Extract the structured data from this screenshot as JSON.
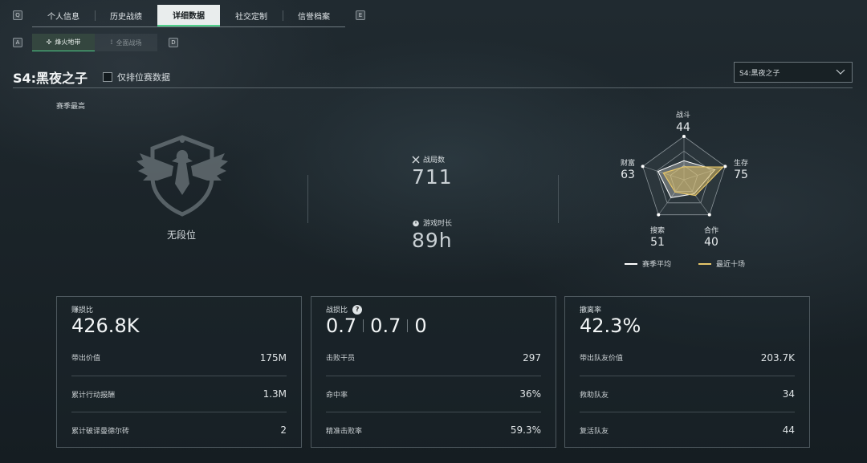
{
  "nav": {
    "key_left": "Q",
    "key_right": "E",
    "tabs": [
      {
        "label": "个人信息"
      },
      {
        "label": "历史战绩"
      },
      {
        "label": "详细数据"
      },
      {
        "label": "社交定制"
      },
      {
        "label": "信誉档案"
      }
    ],
    "active_tab": 2
  },
  "mode": {
    "key_left": "A",
    "key_right": "D",
    "tabs": [
      {
        "label": "烽火地带",
        "icon": "fire-zone-icon"
      },
      {
        "label": "全面战场",
        "icon": "battlefield-icon"
      }
    ],
    "active_tab": 0
  },
  "season": {
    "title": "S4:黑夜之子",
    "ranked_only_label": "仅排位赛数据",
    "ranked_only_checked": false,
    "select_value": "S4:黑夜之子"
  },
  "season_best": {
    "label": "赛季最高",
    "rank_text": "无段位",
    "emblem_icon": "eagle-emblem-icon"
  },
  "summary": {
    "matches_label": "战局数",
    "matches_value": "711",
    "playtime_label": "游戏时长",
    "playtime_value": "89h"
  },
  "radar": {
    "axes": [
      {
        "label": "战斗",
        "value": "44"
      },
      {
        "label": "生存",
        "value": "75"
      },
      {
        "label": "合作",
        "value": "40"
      },
      {
        "label": "搜索",
        "value": "51"
      },
      {
        "label": "财富",
        "value": "63"
      }
    ],
    "season_avg_fraction": [
      0.44,
      0.75,
      0.4,
      0.51,
      0.63
    ],
    "recent_fraction": [
      0.3,
      0.95,
      0.45,
      0.35,
      0.5
    ],
    "legend_avg": "赛季平均",
    "legend_recent": "最近十场",
    "avg_color": "#ffffff",
    "recent_color": "#e6c66a"
  },
  "cards": [
    {
      "title": "赚损比",
      "big": "426.8K",
      "rows": [
        {
          "label": "带出价值",
          "value": "175M"
        },
        {
          "label": "累计行动报酬",
          "value": "1.3M"
        },
        {
          "label": "累计破译曼德尔砖",
          "value": "2"
        }
      ]
    },
    {
      "title": "战损比",
      "help": "?",
      "big_parts": [
        "0.7",
        "0.7",
        "0"
      ],
      "rows": [
        {
          "label": "击败干员",
          "value": "297"
        },
        {
          "label": "命中率",
          "value": "36%"
        },
        {
          "label": "精准击败率",
          "value": "59.3%"
        }
      ]
    },
    {
      "title": "撤离率",
      "big": "42.3%",
      "rows": [
        {
          "label": "带出队友价值",
          "value": "203.7K"
        },
        {
          "label": "救助队友",
          "value": "34"
        },
        {
          "label": "复活队友",
          "value": "44"
        }
      ]
    }
  ],
  "colors": {
    "accent_green": "#4fd08a",
    "legend_gold": "#e6c66a"
  }
}
